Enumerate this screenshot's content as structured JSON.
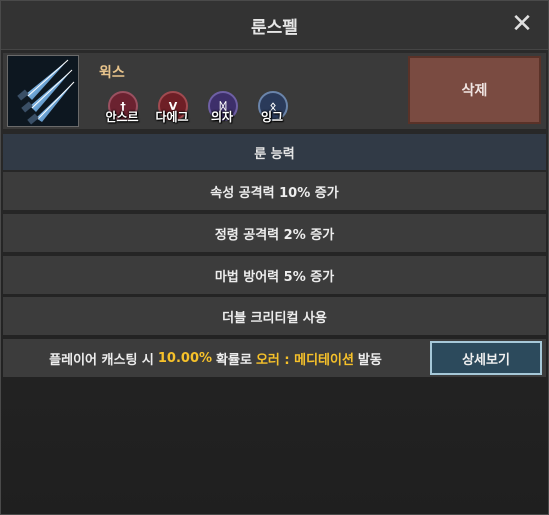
{
  "window": {
    "title": "룬스펠",
    "close_icon": "close-icon"
  },
  "item": {
    "name": "윅스",
    "icon": "triple-blade-icon",
    "tags": [
      {
        "label": "안스르",
        "icon": "rune-gem-red-icon",
        "color": "#6b2230",
        "glyph": "†"
      },
      {
        "label": "다에그",
        "icon": "rune-gem-red-icon",
        "color": "#6e1f26",
        "glyph": "V"
      },
      {
        "label": "의자",
        "icon": "rune-gem-purple-icon",
        "color": "#3d2f6a",
        "glyph": "ᛞ"
      },
      {
        "label": "잉그",
        "icon": "rune-gem-blue-icon",
        "color": "#2a3a5a",
        "glyph": "ᛟ"
      }
    ],
    "delete_label": "삭제"
  },
  "abilities": {
    "header": "룬 능력",
    "lines": [
      "속성 공격력 10% 증가",
      "정령 공격력 2% 증가",
      "마법 방어력 5% 증가",
      "더블 크리티컬 사용"
    ]
  },
  "proc": {
    "prefix": "플레이어 캐스팅 시",
    "chance": "10.00%",
    "middle": "확률로",
    "aura": "오러 : 메디테이션",
    "suffix": "발동",
    "detail_label": "상세보기"
  },
  "colors": {
    "highlight": "#f6c12a",
    "item_name": "#e7c38b",
    "delete_button": "#7a4b41",
    "detail_button": "#2c4a5c"
  }
}
